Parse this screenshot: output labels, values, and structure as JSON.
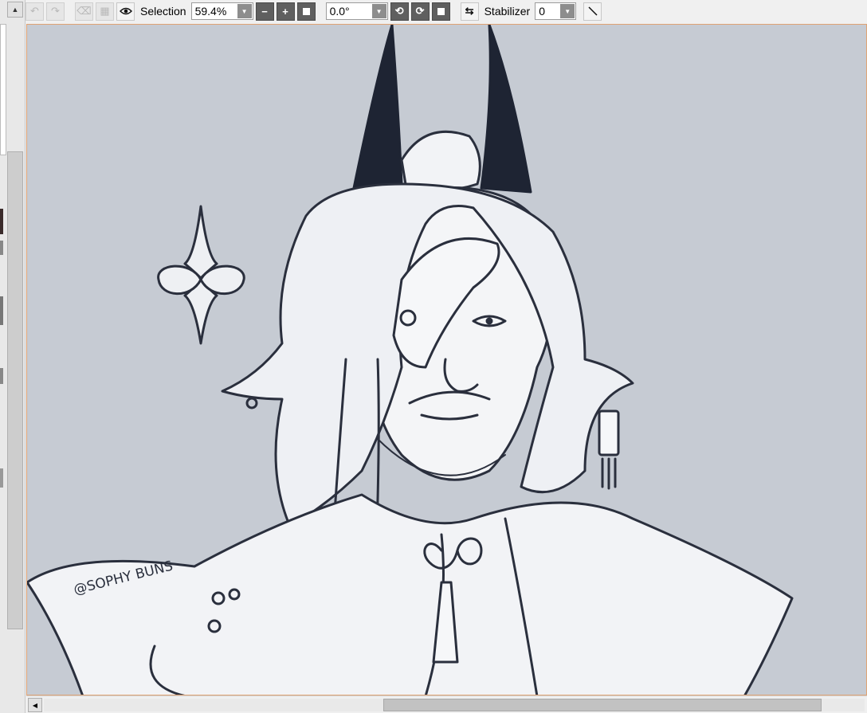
{
  "toolbar": {
    "view_icon": "eye-icon",
    "selection_label": "Selection",
    "zoom_value": "59.4%",
    "rotation_value": "0.0°",
    "stabilizer_label": "Stabilizer",
    "stabilizer_value": "0"
  },
  "canvas": {
    "signature": "@SOPHY BUNS",
    "background_color": "#c6cbd3",
    "border_color": "#e0a373"
  }
}
